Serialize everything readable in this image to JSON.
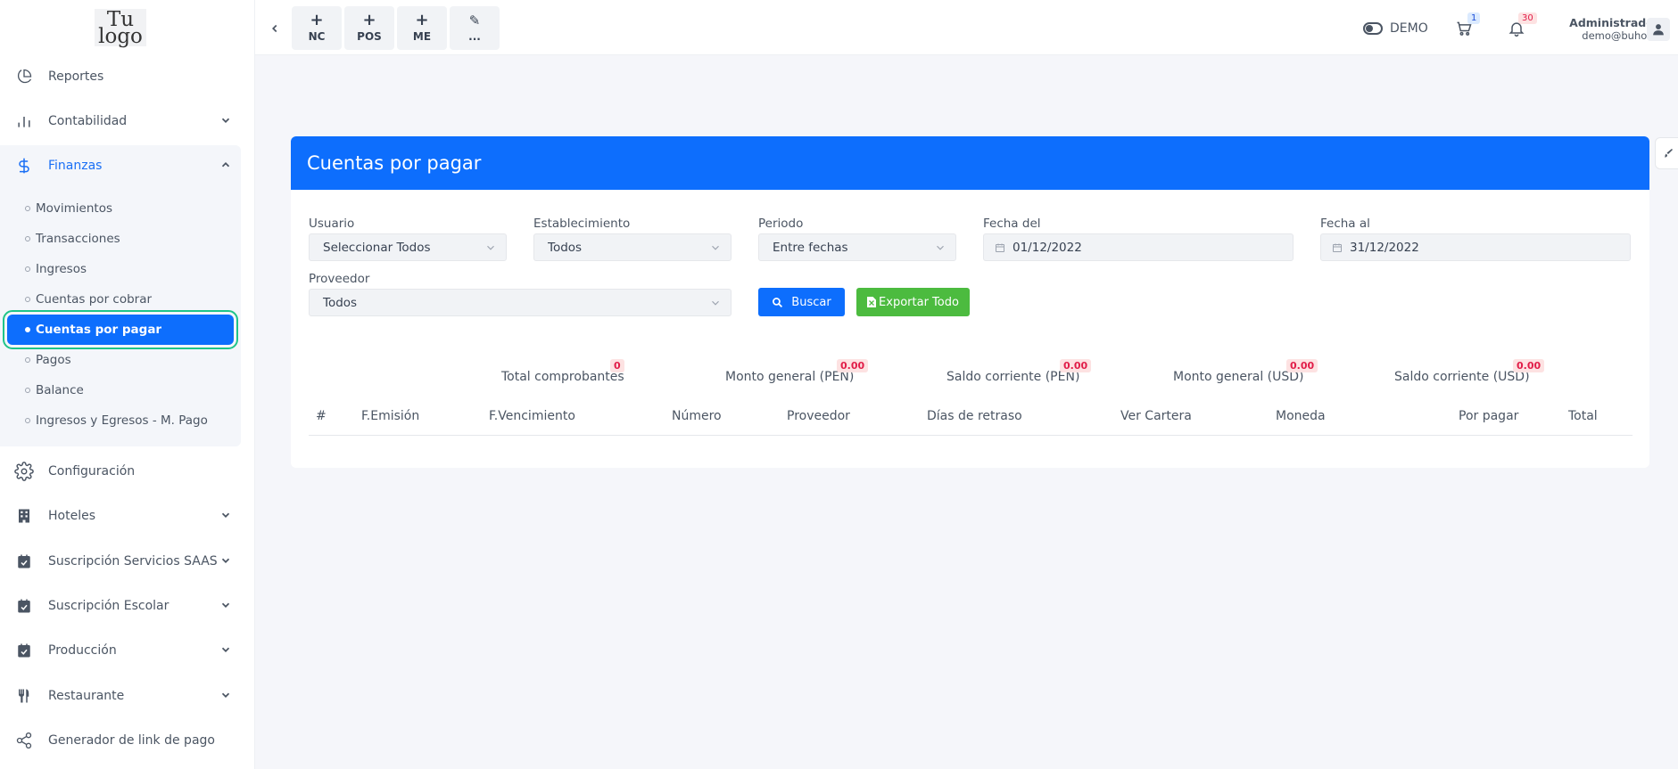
{
  "sidebar": {
    "logo": {
      "line1": "Tu",
      "line2": "logo"
    },
    "items": [
      {
        "label": "Reportes",
        "icon": "pie-chart-icon"
      },
      {
        "label": "Contabilidad",
        "icon": "bar-chart-icon"
      },
      {
        "label": "Finanzas",
        "icon": "dollar-icon"
      },
      {
        "label": "Configuración",
        "icon": "gear-icon"
      },
      {
        "label": "Hoteles",
        "icon": "building-icon"
      },
      {
        "label": "Suscripción Servicios SAAS",
        "icon": "calendar-check-icon"
      },
      {
        "label": "Suscripción Escolar",
        "icon": "calendar-check-icon"
      },
      {
        "label": "Producción",
        "icon": "calendar-check-icon"
      },
      {
        "label": "Restaurante",
        "icon": "fork-knife-icon"
      },
      {
        "label": "Generador de link de pago",
        "icon": "share-icon"
      }
    ],
    "finanzas_sub": [
      "Movimientos",
      "Transacciones",
      "Ingresos",
      "Cuentas por cobrar",
      "Cuentas por pagar",
      "Pagos",
      "Balance",
      "Ingresos y Egresos - M. Pago"
    ]
  },
  "topbar": {
    "quick": [
      {
        "plus": "+",
        "label": "NC"
      },
      {
        "plus": "+",
        "label": "POS"
      },
      {
        "plus": "+",
        "label": "ME"
      },
      {
        "plus": "✎",
        "label": "..."
      }
    ],
    "demo_label": "DEMO",
    "cart_count": "1",
    "notif_count": "30",
    "user_name": "Administrador",
    "user_email": "demo@buho.la"
  },
  "card": {
    "title": "Cuentas por pagar",
    "filters": {
      "usuario_label": "Usuario",
      "usuario_value": "Seleccionar Todos",
      "establecimiento_label": "Establecimiento",
      "establecimiento_value": "Todos",
      "periodo_label": "Periodo",
      "periodo_value": "Entre fechas",
      "fecha_del_label": "Fecha del",
      "fecha_del_value": "01/12/2022",
      "fecha_al_label": "Fecha al",
      "fecha_al_value": "31/12/2022",
      "proveedor_label": "Proveedor",
      "proveedor_value": "Todos"
    },
    "buttons": {
      "search": "Buscar",
      "export": "Exportar Todo"
    },
    "stats": [
      {
        "label": "Total comprobantes",
        "value": "0"
      },
      {
        "label": "Monto general (PEN)",
        "value": "0.00"
      },
      {
        "label": "Saldo corriente (PEN)",
        "value": "0.00"
      },
      {
        "label": "Monto general (USD)",
        "value": "0.00"
      },
      {
        "label": "Saldo corriente (USD)",
        "value": "0.00"
      }
    ],
    "columns": [
      "#",
      "F.Emisión",
      "F.Vencimiento",
      "Número",
      "Proveedor",
      "Días de retraso",
      "Ver Cartera",
      "Moneda",
      "Por pagar",
      "Total"
    ]
  }
}
